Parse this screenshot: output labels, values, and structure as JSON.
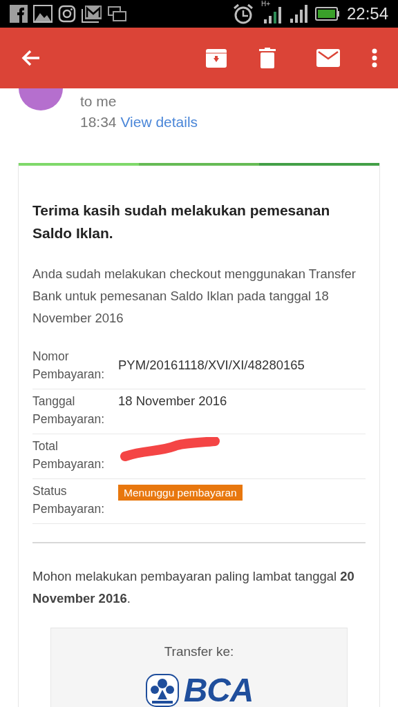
{
  "status_bar": {
    "network": "H+",
    "time": "22:54"
  },
  "header": {
    "recipient": "to me",
    "time": "18:34",
    "details_link": "View details"
  },
  "email": {
    "title": "Terima kasih sudah melakukan pemesanan Saldo Iklan.",
    "intro": "Anda sudah melakukan checkout menggunakan Transfer Bank untuk pemesanan Saldo Iklan pada tanggal 18 November 2016",
    "rows": [
      {
        "label": "Nomor Pembayaran:",
        "kind": "text",
        "value": "PYM/20161118/XVI/XI/48280165"
      },
      {
        "label": "Tanggal Pembayaran:",
        "kind": "text",
        "value": "18 November 2016"
      },
      {
        "label": "Total Pembayaran:",
        "kind": "redacted"
      },
      {
        "label": "Status Pembayaran:",
        "kind": "badge",
        "value": "Menunggu pembayaran",
        "color": "#e8770e"
      }
    ],
    "deadline": "Mohon melakukan pembayaran paling lambat tanggal **20 November 2016**.",
    "transfer": {
      "label": "Transfer ke:",
      "bank": "BCA"
    }
  }
}
